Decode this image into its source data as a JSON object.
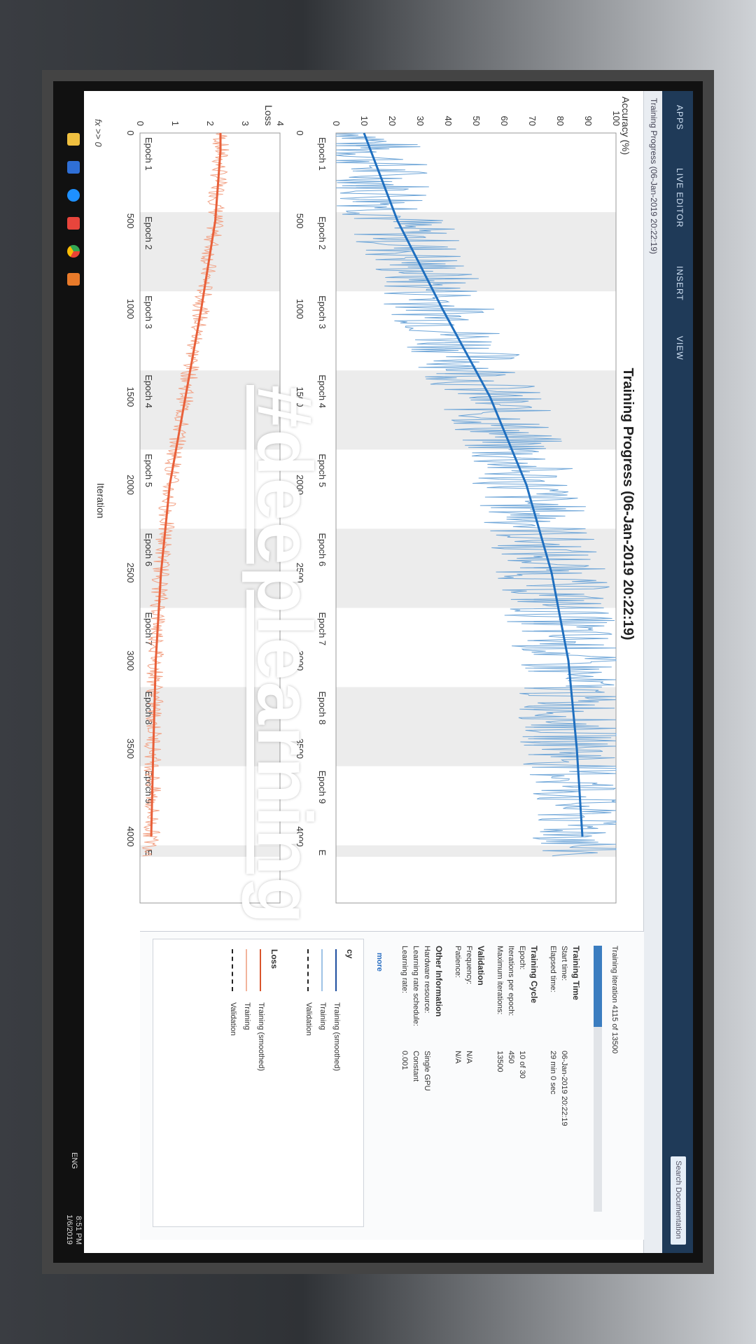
{
  "ribbon": {
    "tabs": [
      "APPS",
      "LIVE EDITOR",
      "INSERT",
      "VIEW"
    ],
    "search_placeholder": "Search Documentation"
  },
  "figure_window": {
    "title": "Training Progress (06-Jan-2019 20:22:19)"
  },
  "plot_title": "Training Progress (06-Jan-2019 20:22:19)",
  "accuracy_plot": {
    "ylabel": "Accuracy (%)",
    "yticks": [
      "0",
      "10",
      "20",
      "30",
      "40",
      "50",
      "60",
      "70",
      "80",
      "90",
      "100"
    ],
    "xticks": [
      "0",
      "500",
      "1000",
      "1500",
      "2000",
      "2500",
      "3000",
      "3500",
      "4000"
    ],
    "xlabel": "Iteration"
  },
  "loss_plot": {
    "ylabel": "Loss",
    "yticks": [
      "0",
      "1",
      "2",
      "3",
      "4"
    ],
    "xticks": [
      "0",
      "500",
      "1000",
      "1500",
      "2000",
      "2500",
      "3000",
      "3500",
      "4000"
    ],
    "xlabel": "Iteration"
  },
  "epochs": [
    "Epoch 1",
    "Epoch 2",
    "Epoch 3",
    "Epoch 4",
    "Epoch 5",
    "Epoch 6",
    "Epoch 7",
    "Epoch 8",
    "Epoch 9",
    "E"
  ],
  "panel": {
    "iteration_text": "Training iteration 4115 of 13500",
    "progress": 0.305,
    "training_time_hdr": "Training Time",
    "start_time_label": "Start time:",
    "start_time_value": "06-Jan-2019 20:22:19",
    "elapsed_label": "Elapsed time:",
    "elapsed_value": "29 min 0 sec",
    "cycle_hdr": "Training Cycle",
    "epoch_label": "Epoch:",
    "epoch_value": "10 of 30",
    "ipe_label": "Iterations per epoch:",
    "ipe_value": "450",
    "maxit_label": "Maximum iterations:",
    "maxit_value": "13500",
    "validation_hdr": "Validation",
    "freq_label": "Frequency:",
    "freq_value": "N/A",
    "patience_label": "Patience:",
    "patience_value": "N/A",
    "other_hdr": "Other Information",
    "hw_label": "Hardware resource:",
    "hw_value": "Single GPU",
    "lrs_label": "Learning rate schedule:",
    "lrs_value": "Constant",
    "lr_label": "Learning rate:",
    "lr_value": "0.001",
    "more_link": "more",
    "accuracy_hdr": "cy",
    "acc_train_smooth": "Training (smoothed)",
    "acc_train": "Training",
    "acc_val": "Validation",
    "loss_hdr": "Loss",
    "loss_train_smooth": "Training (smoothed)",
    "loss_train": "Training",
    "loss_val": "Validation"
  },
  "command_line": "fx >> 0",
  "watermark": "#deeplearning",
  "taskbar": {
    "lang": "ENG",
    "time": "8:51 PM",
    "date": "1/6/2019"
  },
  "colors": {
    "accuracy": "#1f6fbf",
    "loss": "#e8603a",
    "ribbon": "#1f3a58"
  },
  "chart_data": [
    {
      "type": "line",
      "title": "",
      "ylabel": "Accuracy (%)",
      "xlabel": "Iteration",
      "xlim": [
        0,
        4115
      ],
      "ylim": [
        0,
        100
      ],
      "series": [
        {
          "name": "Training (smoothed)",
          "x": [
            0,
            500,
            1000,
            1500,
            2000,
            2500,
            3000,
            3500,
            4000
          ],
          "values": [
            10,
            22,
            38,
            55,
            68,
            77,
            83,
            86,
            88
          ]
        }
      ]
    },
    {
      "type": "line",
      "title": "",
      "ylabel": "Loss",
      "xlabel": "Iteration",
      "xlim": [
        0,
        4115
      ],
      "ylim": [
        0,
        4
      ],
      "series": [
        {
          "name": "Training (smoothed)",
          "x": [
            0,
            100,
            500,
            1000,
            1500,
            2000,
            2500,
            3000,
            3500,
            4000
          ],
          "values": [
            2.3,
            2.3,
            2.15,
            1.75,
            1.3,
            0.85,
            0.6,
            0.45,
            0.38,
            0.32
          ]
        }
      ]
    }
  ]
}
